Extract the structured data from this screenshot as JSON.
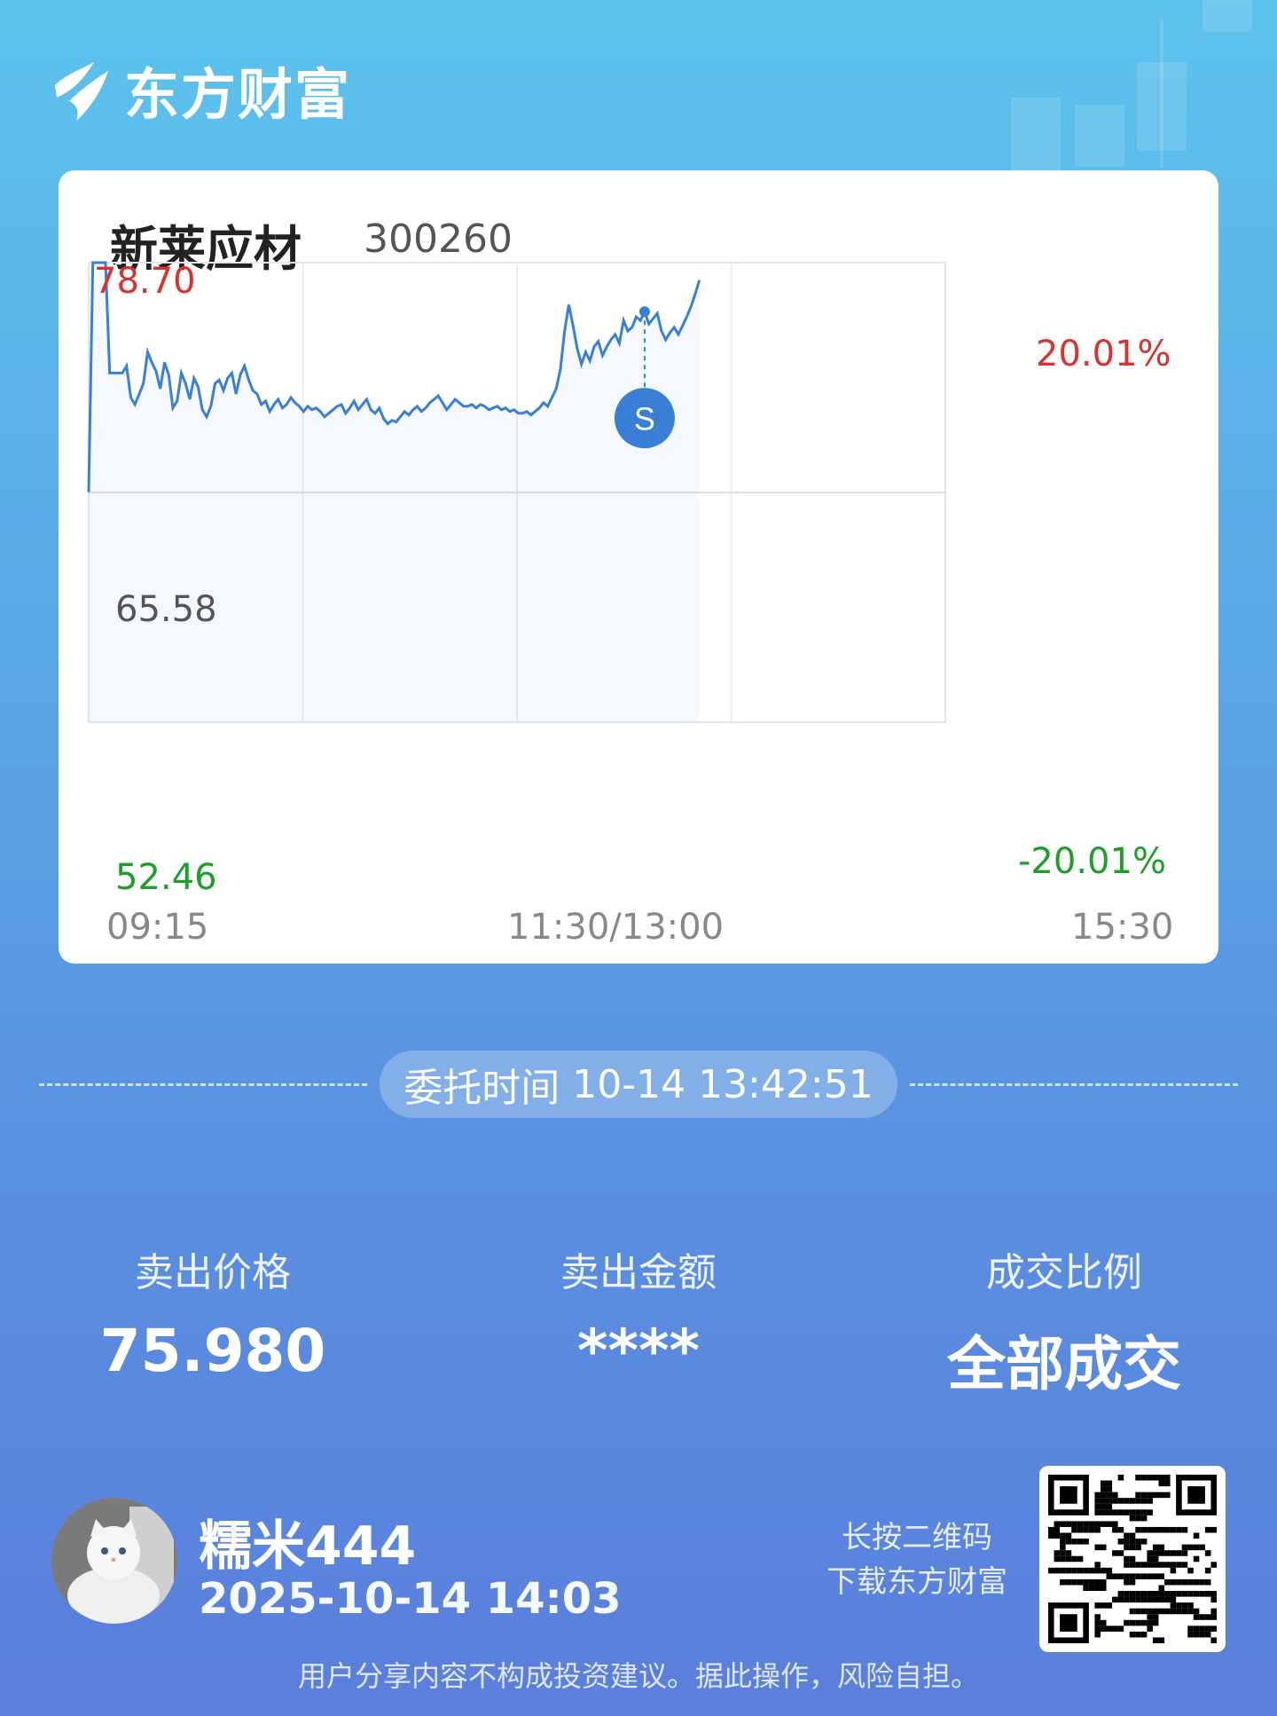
{
  "brand": {
    "name": "东方财富"
  },
  "stock": {
    "name": "新莱应材",
    "code": "300260"
  },
  "chart_data": {
    "type": "line",
    "title": "",
    "y_labels": {
      "high": "78.70",
      "mid": "65.58",
      "low": "52.46"
    },
    "pct_labels": {
      "high": "20.01%",
      "low": "-20.01%"
    },
    "x_labels": [
      "09:15",
      "11:30/13:00",
      "15:30"
    ],
    "ylim": [
      52.46,
      78.7
    ],
    "reference_price": 65.58,
    "marker_label": "S",
    "marker_price": 75.98,
    "series": [
      {
        "values": [
          65.6,
          78.7,
          78.7,
          78.7,
          78.7,
          72.4,
          72.4,
          72.4,
          72.4,
          72.8,
          71.0,
          70.6,
          71.2,
          71.8,
          73.6,
          73.0,
          72.5,
          71.5,
          73.0,
          72.3,
          70.4,
          70.8,
          72.4,
          71.8,
          70.9,
          72.1,
          71.6,
          70.3,
          69.9,
          70.5,
          71.8,
          72.0,
          71.4,
          72.1,
          72.4,
          71.2,
          72.3,
          72.8,
          72.0,
          71.4,
          71.2,
          70.6,
          70.8,
          70.2,
          70.6,
          70.9,
          70.4,
          70.6,
          71.0,
          70.7,
          70.5,
          70.2,
          70.5,
          70.3,
          70.4,
          70.2,
          69.9,
          70.1,
          70.3,
          70.5,
          70.6,
          70.1,
          70.4,
          70.8,
          70.3,
          70.6,
          70.9,
          70.3,
          70.1,
          70.4,
          69.8,
          69.5,
          69.7,
          69.6,
          69.9,
          70.2,
          70.0,
          70.3,
          70.5,
          70.2,
          70.4,
          70.7,
          70.9,
          71.1,
          70.7,
          70.3,
          70.6,
          70.9,
          70.7,
          70.5,
          70.5,
          70.6,
          70.4,
          70.6,
          70.5,
          70.3,
          70.4,
          70.5,
          70.3,
          70.4,
          70.2,
          70.3,
          70.1,
          70.1,
          70.2,
          70.0,
          70.2,
          70.4,
          70.7,
          70.5,
          71.0,
          71.5,
          72.6,
          74.8,
          76.3,
          75.1,
          73.8,
          72.9,
          73.6,
          73.1,
          73.9,
          74.2,
          73.4,
          73.9,
          74.3,
          74.6,
          74.1,
          75.4,
          74.8,
          75.0,
          75.6,
          75.4,
          75.9,
          75.2,
          75.5,
          75.8,
          74.8,
          74.3,
          74.7,
          75.0,
          74.6,
          75.1,
          75.6,
          76.2,
          76.9,
          77.7
        ]
      }
    ],
    "grid": true,
    "area_fill": true
  },
  "order": {
    "label": "委托时间",
    "value": "10-14 13:42:51"
  },
  "stats": [
    {
      "label": "卖出价格",
      "value": "75.980"
    },
    {
      "label": "卖出金额",
      "value": "****"
    },
    {
      "label": "成交比例",
      "value": "全部成交"
    }
  ],
  "user": {
    "name": "糯米444",
    "time": "2025-10-14 14:03"
  },
  "qr": {
    "line1": "长按二维码",
    "line2": "下载东方财富"
  },
  "disclaimer": "用户分享内容不构成投资建议。据此操作，风险自担。",
  "colors": {
    "line": "#3a7fd6",
    "up": "#d63331",
    "down": "#1e9e2a",
    "marker": "#3a7fd6"
  }
}
